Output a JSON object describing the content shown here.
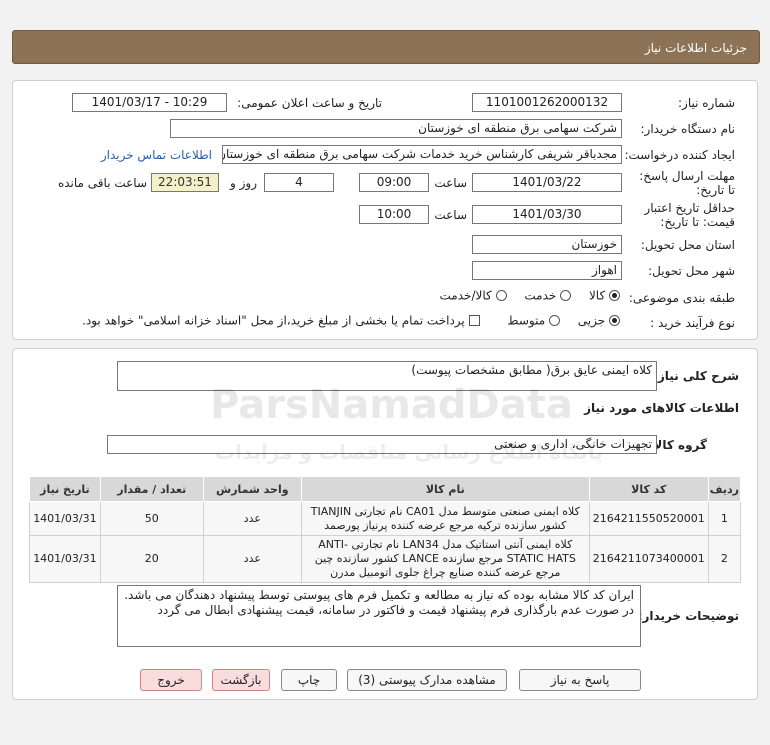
{
  "header": {
    "title": "جزئیات اطلاعات نیاز"
  },
  "form": {
    "need_number_label": "شماره نیاز:",
    "need_number": "1101001262000132",
    "announce_label": "تاریخ و ساعت اعلان عمومی:",
    "announce_value": "1401/03/17 - 10:29",
    "buyer_org_label": "نام دستگاه خریدار:",
    "buyer_org": "شرکت سهامی برق منطقه ای خوزستان",
    "requester_label": "ایجاد کننده درخواست:",
    "requester": "مجدباقر شریفی کارشناس خرید خدمات شرکت سهامی برق منطقه ای خوزستان",
    "contact_link": "اطلاعات تماس خریدار",
    "deadline_label": "مهلت ارسال پاسخ: تا تاریخ:",
    "deadline_date": "1401/03/22",
    "time_label": "ساعت",
    "deadline_time": "09:00",
    "days_value": "4",
    "days_label": "روز و",
    "remaining_time": "22:03:51",
    "remaining_label": "ساعت باقی مانده",
    "validity_label": "حداقل تاریخ اعتبار قیمت: تا تاریخ:",
    "validity_date": "1401/03/30",
    "validity_time_label": "ساعت",
    "validity_time": "10:00",
    "province_label": "استان محل تحویل:",
    "province": "خوزستان",
    "city_label": "شهر محل تحویل:",
    "city": "اهواز",
    "category_label": "طبقه بندی موضوعی:",
    "category_options": [
      {
        "label": "کالا",
        "selected": true
      },
      {
        "label": "خدمت",
        "selected": false
      },
      {
        "label": "کالا/خدمت",
        "selected": false
      }
    ],
    "process_label": "نوع فرآیند خرید :",
    "process_options": [
      {
        "label": "جزیی",
        "selected": true
      },
      {
        "label": "متوسط",
        "selected": false
      }
    ],
    "payment_note": "پرداخت تمام یا بخشی از مبلغ خرید،از محل \"اسناد خزانه اسلامی\" خواهد بود."
  },
  "details": {
    "description_label": "شرح کلی نیاز:",
    "description": "کلاه ایمنی عایق برق( مطابق مشخصات پیوست)",
    "goods_info_title": "اطلاعات کالاهای مورد نیاز",
    "goods_group_label": "گروه کالا:",
    "goods_group": "تجهیزات خانگی، اداری و صنعتی",
    "table": {
      "headers": [
        "ردیف",
        "کد کالا",
        "نام کالا",
        "واحد شمارش",
        "تعداد / مقدار",
        "تاریخ نیاز"
      ],
      "rows": [
        [
          "1",
          "2164211550520001",
          "کلاه ایمنی صنعتی متوسط مدل CA01 نام تجارتی TIANJIN کشور سازنده ترکیه مرجع عرضه کننده پرنیاز پورصمد",
          "عدد",
          "50",
          "1401/03/31"
        ],
        [
          "2",
          "2164211073400001",
          "کلاه ایمنی آنتی استاتیک مدل LAN34 نام تجارتی -ANTI STATIC HATS مرجع سازنده LANCE کشور سازنده چین مرجع عرضه کننده صنایع چراغ جلوی اتومبیل مدرن",
          "عدد",
          "20",
          "1401/03/31"
        ]
      ]
    },
    "buyer_notes_label": "توضیحات خریدار:",
    "buyer_notes": "ایران کد کالا مشابه بوده که نیاز به مطالعه و تکمیل فرم های پیوستی توسط پیشنهاد دهندگان می باشد.\nدر صورت عدم بارگذاری فرم پیشنهاد قیمت و فاکتور در سامانه، قیمت پیشنهادی ابطال می گردد"
  },
  "buttons": {
    "reply": "پاسخ به نیاز",
    "attachments": "مشاهده مدارک پیوستی (3)",
    "print": "چاپ",
    "back": "بازگشت",
    "exit": "خروج"
  },
  "watermark": {
    "brand": "ParsNamadData",
    "persian": "پایگاه اطلاع رسانی مناقصات و مزایدات"
  }
}
